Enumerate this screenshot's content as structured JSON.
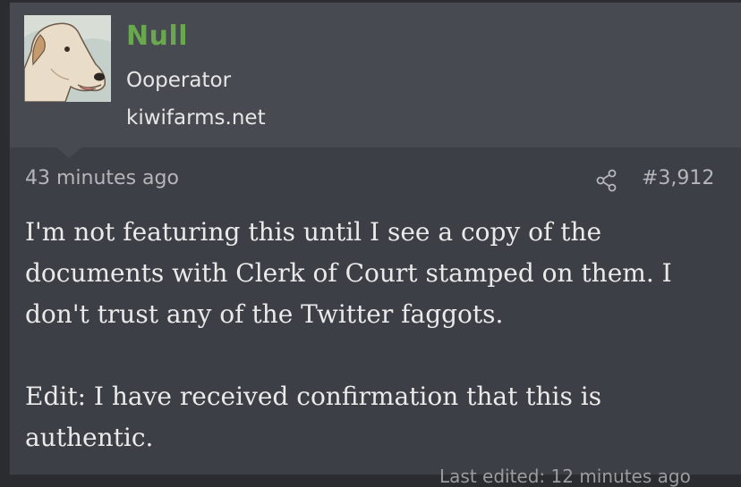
{
  "user": {
    "name": "Null",
    "title": "Ooperator",
    "banner": "kiwifarms.net"
  },
  "post": {
    "time": "43 minutes ago",
    "number": "#3,912",
    "paragraphs": [
      "I'm not featuring this until I see a copy of the documents with Clerk of Court stamped on them. I don't trust any of the Twitter faggots.",
      "Edit: I have received confirmation that this is authentic."
    ],
    "last_edited": "Last edited: 12 minutes ago"
  },
  "icons": {
    "avatar": "dog-avatar",
    "share": "share-icon"
  },
  "colors": {
    "username": "#6aa84f",
    "userblock_bg": "#474a50",
    "post_bg": "#3c3f45"
  }
}
